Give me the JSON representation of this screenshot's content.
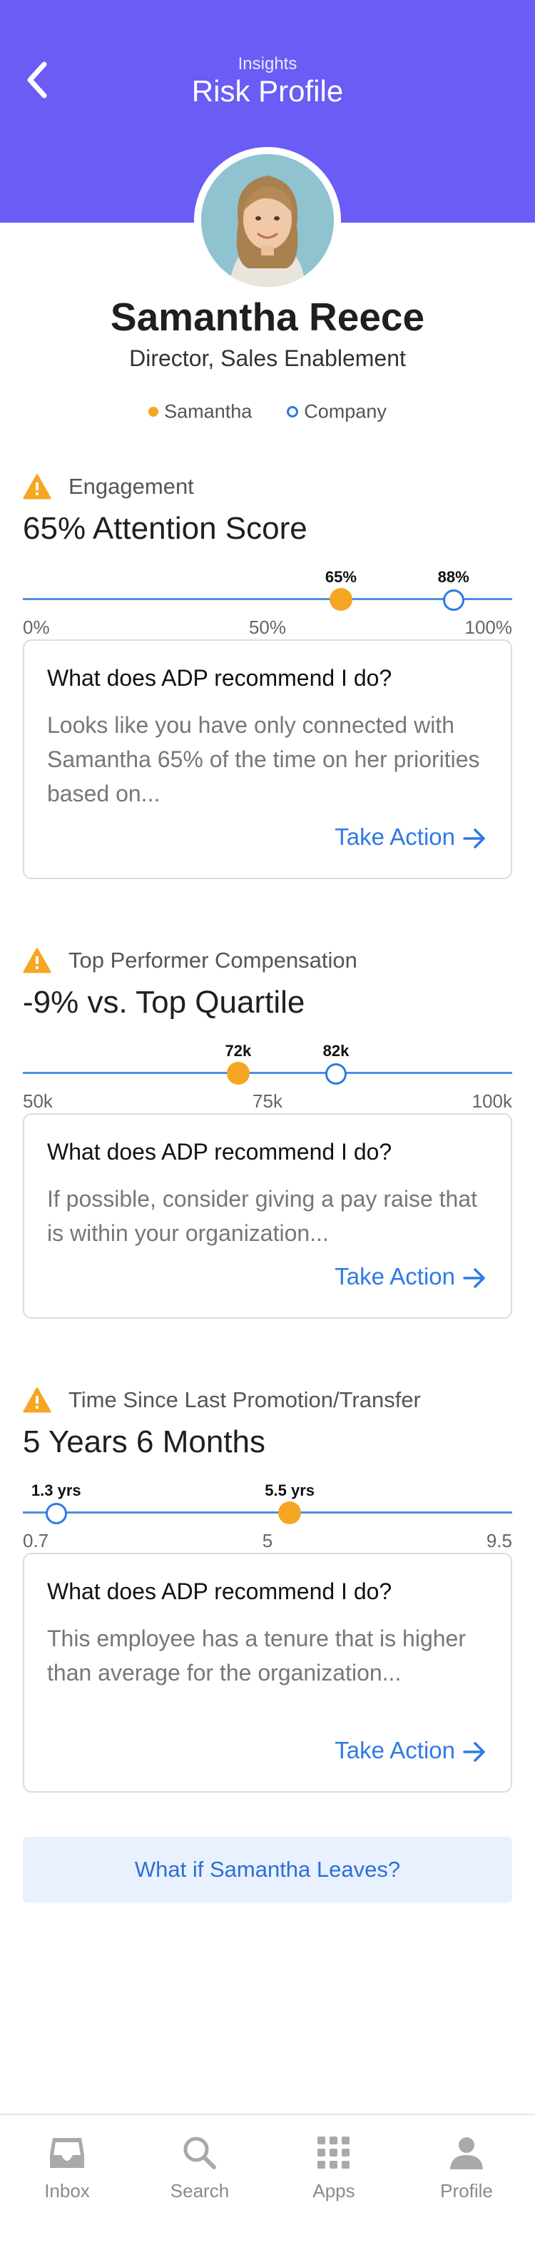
{
  "header": {
    "subtitle": "Insights",
    "title": "Risk Profile"
  },
  "profile": {
    "name": "Samantha Reece",
    "role": "Director, Sales Enablement"
  },
  "legend": {
    "employee": "Samantha",
    "company": "Company"
  },
  "sections": [
    {
      "title": "Engagement",
      "metric": "65% Attention Score",
      "slider": {
        "min_label": "0%",
        "mid_label": "50%",
        "max_label": "100%",
        "min": 0,
        "max": 100,
        "employee_value": 65,
        "employee_label": "65%",
        "company_value": 88,
        "company_label": "88%"
      },
      "card": {
        "question": "What does ADP recommend I do?",
        "body": "Looks like you have only connected with Samantha 65% of the time on her priorities based on...",
        "action": "Take Action"
      }
    },
    {
      "title": "Top Performer Compensation",
      "metric": "-9% vs. Top Quartile",
      "slider": {
        "min_label": "50k",
        "mid_label": "75k",
        "max_label": "100k",
        "min": 50,
        "max": 100,
        "employee_value": 72,
        "employee_label": "72k",
        "company_value": 82,
        "company_label": "82k"
      },
      "card": {
        "question": "What does ADP recommend I do?",
        "body": "If possible, consider giving a pay raise that is within your organization...",
        "action": "Take Action"
      }
    },
    {
      "title": "Time Since Last Promotion/Transfer",
      "metric": "5 Years 6 Months",
      "slider": {
        "min_label": "0.7",
        "mid_label": "5",
        "max_label": "9.5",
        "min": 0.7,
        "max": 9.5,
        "employee_value": 5.5,
        "employee_label": "5.5 yrs",
        "company_value": 1.3,
        "company_label": "1.3 yrs"
      },
      "card": {
        "question": "What does ADP recommend I do?",
        "body": "This employee has a tenure that is higher than average for the organization...",
        "action": "Take Action"
      }
    }
  ],
  "cta": "What if Samantha Leaves?",
  "tabs": [
    {
      "label": "Inbox",
      "icon": "inbox-icon"
    },
    {
      "label": "Search",
      "icon": "search-icon"
    },
    {
      "label": "Apps",
      "icon": "apps-grid-icon"
    },
    {
      "label": "Profile",
      "icon": "profile-icon"
    }
  ],
  "colors": {
    "header": "#6a5cf5",
    "employee": "#f5a623",
    "company": "#2f7ae5",
    "link": "#2f7ae5",
    "cta_bg": "#e8f1fd"
  }
}
